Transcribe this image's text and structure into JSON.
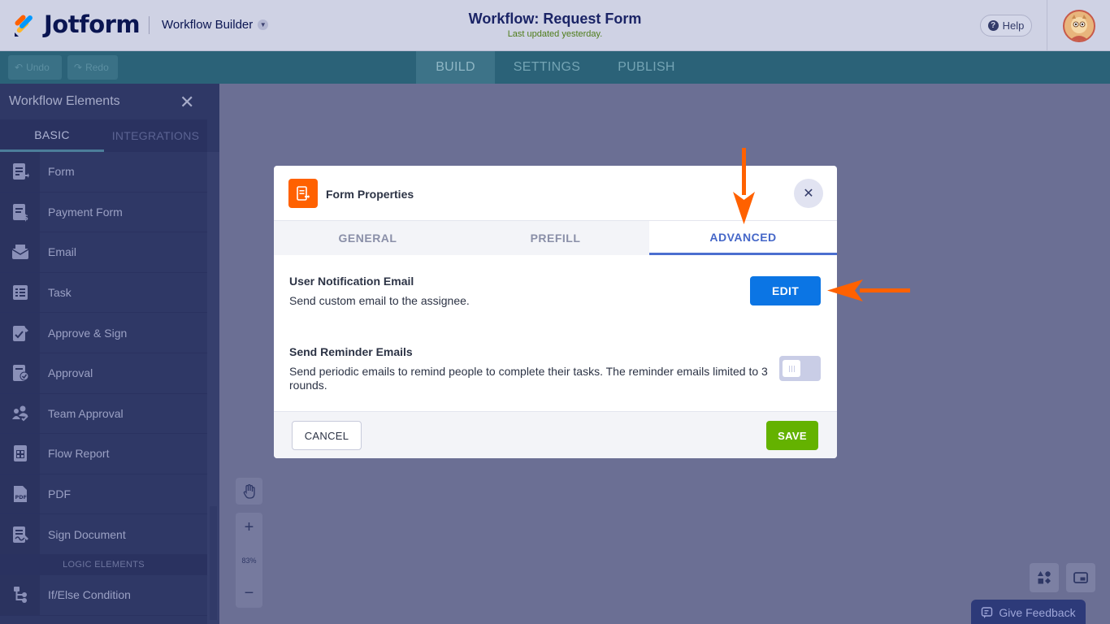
{
  "header": {
    "logo_text": "Jotform",
    "builder_menu": "Workflow Builder",
    "title": "Workflow: Request Form",
    "subtitle": "Last updated yesterday.",
    "help_label": "Help"
  },
  "toolbar": {
    "undo_label": "Undo",
    "redo_label": "Redo",
    "tabs": [
      {
        "label": "BUILD"
      },
      {
        "label": "SETTINGS"
      },
      {
        "label": "PUBLISH"
      }
    ]
  },
  "sidebar": {
    "title": "Workflow Elements",
    "tabs": [
      {
        "label": "BASIC"
      },
      {
        "label": "INTEGRATIONS"
      }
    ],
    "items": [
      {
        "label": "Form",
        "icon": "form-icon"
      },
      {
        "label": "Payment Form",
        "icon": "payment-form-icon"
      },
      {
        "label": "Email",
        "icon": "email-icon"
      },
      {
        "label": "Task",
        "icon": "task-icon"
      },
      {
        "label": "Approve & Sign",
        "icon": "approve-sign-icon"
      },
      {
        "label": "Approval",
        "icon": "approval-icon"
      },
      {
        "label": "Team Approval",
        "icon": "team-approval-icon"
      },
      {
        "label": "Flow Report",
        "icon": "flow-report-icon"
      },
      {
        "label": "PDF",
        "icon": "pdf-icon"
      },
      {
        "label": "Sign Document",
        "icon": "sign-document-icon"
      }
    ],
    "section_label": "LOGIC ELEMENTS",
    "logic_items": [
      {
        "label": "If/Else Condition",
        "icon": "if-else-icon"
      }
    ]
  },
  "canvas": {
    "zoom_level": "83%"
  },
  "feedback_label": "Give Feedback",
  "modal": {
    "title": "Form Properties",
    "tabs": [
      {
        "label": "GENERAL"
      },
      {
        "label": "PREFILL"
      },
      {
        "label": "ADVANCED",
        "active": true
      }
    ],
    "notification": {
      "title": "User Notification Email",
      "description": "Send custom email to the assignee.",
      "button_label": "EDIT"
    },
    "reminder": {
      "title": "Send Reminder Emails",
      "description": "Send periodic emails to remind people to complete their tasks. The reminder emails limited to 3 rounds.",
      "enabled": false
    },
    "cancel_label": "CANCEL",
    "save_label": "SAVE"
  },
  "colors": {
    "accent": "#ff6100",
    "primary_button": "#0b75e4",
    "save_button": "#64b200",
    "active_tab": "#4567c8",
    "annotation_arrow": "#ff6100"
  }
}
